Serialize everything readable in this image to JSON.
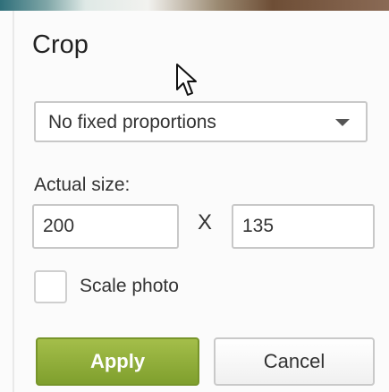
{
  "crop": {
    "title": "Crop",
    "proportion": {
      "selected": "No fixed proportions"
    },
    "actual_size": {
      "label": "Actual size:",
      "width": "200",
      "separator": "X",
      "height": "135"
    },
    "scale_photo": {
      "label": "Scale photo",
      "checked": false
    },
    "buttons": {
      "apply": "Apply",
      "cancel": "Cancel"
    }
  },
  "colors": {
    "apply_button": "#8fae36",
    "panel_background": "#fbfbfb"
  },
  "icons": {
    "cursor": "mouse-pointer-icon",
    "dropdown": "chevron-down-icon"
  }
}
